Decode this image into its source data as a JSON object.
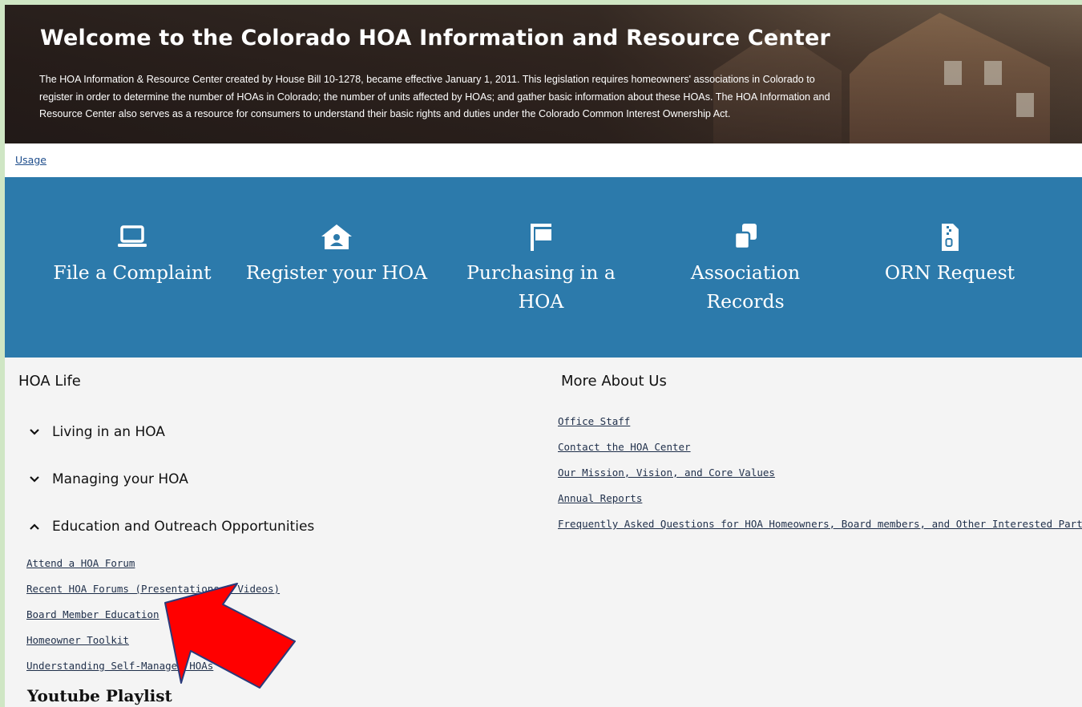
{
  "hero": {
    "title": "Welcome to the Colorado HOA Information and Resource Center",
    "description": "The HOA Information & Resource Center created by House Bill 10-1278, became effective January 1, 2011. This legislation requires homeowners' associations in Colorado to register in order to determine the number of HOAs in Colorado; the number of units affected by HOAs; and gather basic information about these HOAs. The HOA Information and Resource Center also serves as a resource for consumers to understand their basic rights and duties under the Colorado Common Interest Ownership Act."
  },
  "usage_link": "Usage",
  "quick_links": [
    {
      "label": "File a Complaint",
      "icon": "laptop-icon"
    },
    {
      "label": "Register your HOA",
      "icon": "home-user-icon"
    },
    {
      "label": "Purchasing in a HOA",
      "icon": "sign-post-icon"
    },
    {
      "label": "Association Records",
      "icon": "copy-icon"
    },
    {
      "label": "ORN Request",
      "icon": "file-zipper-icon"
    }
  ],
  "hoa_life": {
    "heading": "HOA Life",
    "accordions": [
      {
        "label": "Living in an HOA",
        "expanded": false
      },
      {
        "label": "Managing your HOA",
        "expanded": false
      },
      {
        "label": "Education and Outreach Opportunities",
        "expanded": true
      }
    ],
    "education_links": [
      "Attend a HOA Forum",
      "Recent HOA Forums (Presentations & Videos)",
      "Board Member Education",
      "Homeowner Toolkit",
      "Understanding Self-Managed HOAs"
    ],
    "youtube_heading": "Youtube Playlist"
  },
  "more_about_us": {
    "heading": "More About Us",
    "links": [
      "Office Staff",
      "Contact the HOA Center",
      "Our Mission, Vision, and Core Values",
      "Annual Reports",
      "Frequently Asked Questions for HOA Homeowners, Board members, and Other Interested Parties"
    ]
  },
  "colors": {
    "band_blue": "#2c7aab",
    "arrow_red": "#ff0000",
    "page_background": "#f4f4f4",
    "frame_green": "#cfe6c4"
  }
}
